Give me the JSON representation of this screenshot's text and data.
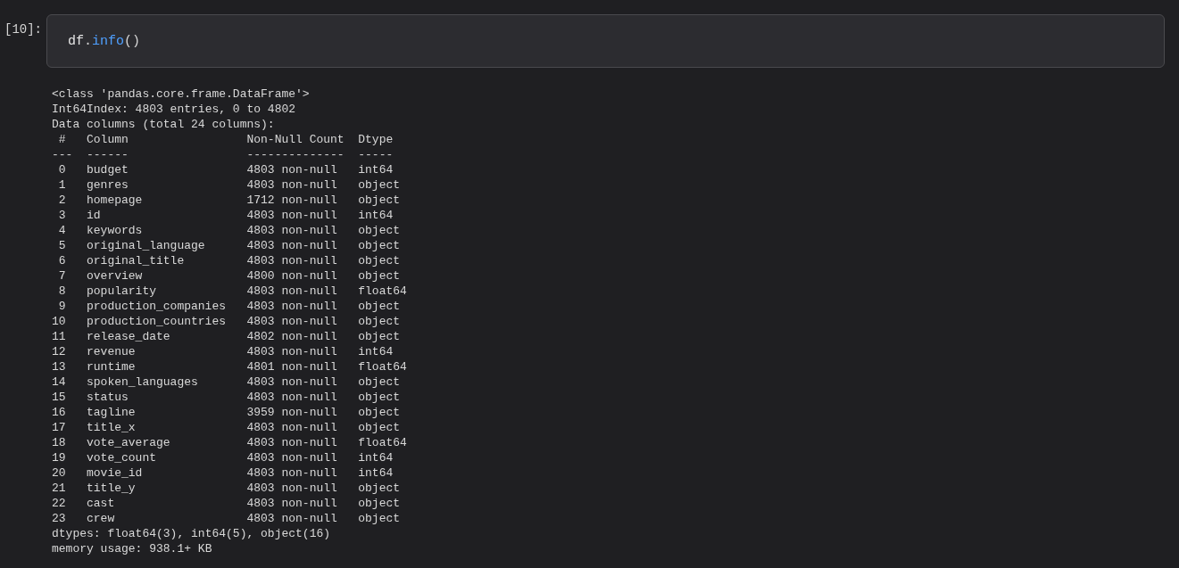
{
  "cell": {
    "prompt": "[10]:",
    "code": [
      {
        "kind": "name",
        "text": "df"
      },
      {
        "kind": "punct",
        "text": "."
      },
      {
        "kind": "call",
        "text": "info"
      },
      {
        "kind": "punct",
        "text": "()"
      }
    ]
  },
  "output": {
    "preamble": [
      "<class 'pandas.core.frame.DataFrame'>",
      "Int64Index: 4803 entries, 0 to 4802",
      "Data columns (total 24 columns):"
    ],
    "table": {
      "columns": [
        "#",
        "Column",
        "Non-Null Count",
        "Dtype"
      ],
      "rules": [
        "---",
        "------",
        "--------------",
        "-----"
      ],
      "rows": [
        {
          "index": "0",
          "column": "budget",
          "count": "4803 non-null",
          "dtype": "int64"
        },
        {
          "index": "1",
          "column": "genres",
          "count": "4803 non-null",
          "dtype": "object"
        },
        {
          "index": "2",
          "column": "homepage",
          "count": "1712 non-null",
          "dtype": "object"
        },
        {
          "index": "3",
          "column": "id",
          "count": "4803 non-null",
          "dtype": "int64"
        },
        {
          "index": "4",
          "column": "keywords",
          "count": "4803 non-null",
          "dtype": "object"
        },
        {
          "index": "5",
          "column": "original_language",
          "count": "4803 non-null",
          "dtype": "object"
        },
        {
          "index": "6",
          "column": "original_title",
          "count": "4803 non-null",
          "dtype": "object"
        },
        {
          "index": "7",
          "column": "overview",
          "count": "4800 non-null",
          "dtype": "object"
        },
        {
          "index": "8",
          "column": "popularity",
          "count": "4803 non-null",
          "dtype": "float64"
        },
        {
          "index": "9",
          "column": "production_companies",
          "count": "4803 non-null",
          "dtype": "object"
        },
        {
          "index": "10",
          "column": "production_countries",
          "count": "4803 non-null",
          "dtype": "object"
        },
        {
          "index": "11",
          "column": "release_date",
          "count": "4802 non-null",
          "dtype": "object"
        },
        {
          "index": "12",
          "column": "revenue",
          "count": "4803 non-null",
          "dtype": "int64"
        },
        {
          "index": "13",
          "column": "runtime",
          "count": "4801 non-null",
          "dtype": "float64"
        },
        {
          "index": "14",
          "column": "spoken_languages",
          "count": "4803 non-null",
          "dtype": "object"
        },
        {
          "index": "15",
          "column": "status",
          "count": "4803 non-null",
          "dtype": "object"
        },
        {
          "index": "16",
          "column": "tagline",
          "count": "3959 non-null",
          "dtype": "object"
        },
        {
          "index": "17",
          "column": "title_x",
          "count": "4803 non-null",
          "dtype": "object"
        },
        {
          "index": "18",
          "column": "vote_average",
          "count": "4803 non-null",
          "dtype": "float64"
        },
        {
          "index": "19",
          "column": "vote_count",
          "count": "4803 non-null",
          "dtype": "int64"
        },
        {
          "index": "20",
          "column": "movie_id",
          "count": "4803 non-null",
          "dtype": "int64"
        },
        {
          "index": "21",
          "column": "title_y",
          "count": "4803 non-null",
          "dtype": "object"
        },
        {
          "index": "22",
          "column": "cast",
          "count": "4803 non-null",
          "dtype": "object"
        },
        {
          "index": "23",
          "column": "crew",
          "count": "4803 non-null",
          "dtype": "object"
        }
      ]
    },
    "footer": [
      "dtypes: float64(3), int64(5), object(16)",
      "memory usage: 938.1+ KB"
    ]
  }
}
